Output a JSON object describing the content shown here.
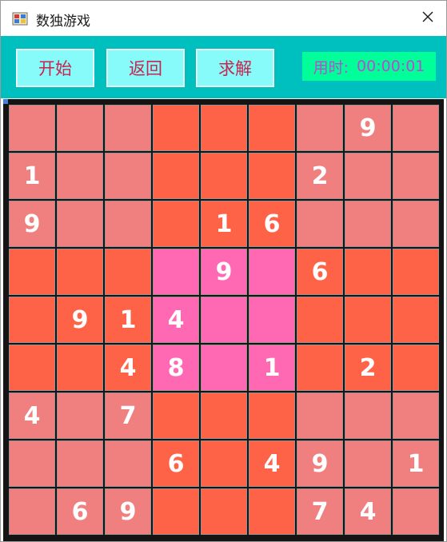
{
  "window": {
    "title": "数独游戏",
    "icon": "sudoku-app-icon",
    "close_icon": "close-icon"
  },
  "toolbar": {
    "start_label": "开始",
    "back_label": "返回",
    "solve_label": "求解",
    "timer_label": "用时:",
    "timer_value": "00:00:01"
  },
  "colors": {
    "toolbar_bg": "#00bfbf",
    "button_bg": "#87fafa",
    "button_text": "#c8244e",
    "timer_bg": "#00ff99",
    "timer_text": "#b94bd0",
    "block_light": "#f08080",
    "block_dark": "#ff6347",
    "block_center": "#ff69b4"
  },
  "board": {
    "rows": [
      [
        "",
        "",
        "",
        "",
        "",
        "",
        "",
        "9",
        ""
      ],
      [
        "1",
        "",
        "",
        "",
        "",
        "",
        "2",
        "",
        ""
      ],
      [
        "9",
        "",
        "",
        "",
        "1",
        "6",
        "",
        "",
        ""
      ],
      [
        "",
        "",
        "",
        "",
        "9",
        "",
        "6",
        "",
        ""
      ],
      [
        "",
        "9",
        "1",
        "4",
        "",
        "",
        "",
        "",
        ""
      ],
      [
        "",
        "",
        "4",
        "8",
        "",
        "1",
        "",
        "2",
        ""
      ],
      [
        "4",
        "",
        "7",
        "",
        "",
        "",
        "",
        "",
        ""
      ],
      [
        "",
        "",
        "",
        "6",
        "",
        "4",
        "9",
        "",
        "1"
      ],
      [
        "",
        "6",
        "9",
        "",
        "",
        "",
        "7",
        "4",
        ""
      ]
    ],
    "block_colors": [
      [
        "light",
        "dark",
        "light"
      ],
      [
        "dark",
        "center",
        "dark"
      ],
      [
        "light",
        "dark",
        "light"
      ]
    ]
  }
}
